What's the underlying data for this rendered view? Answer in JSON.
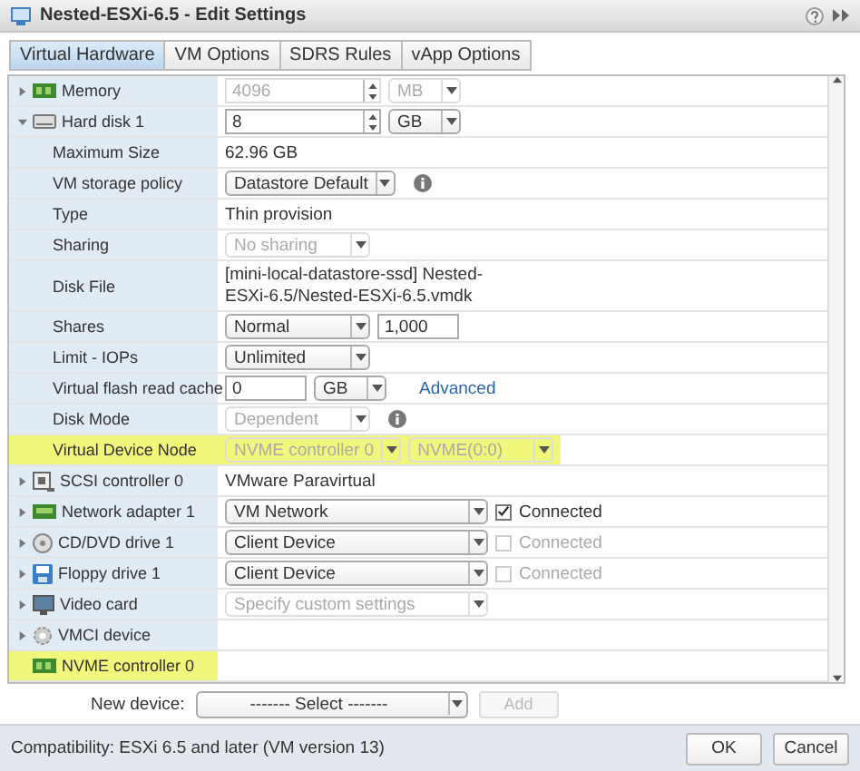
{
  "window": {
    "title": "Nested-ESXi-6.5 - Edit Settings"
  },
  "tabs": [
    {
      "label": "Virtual Hardware",
      "selected": true
    },
    {
      "label": "VM Options",
      "selected": false
    },
    {
      "label": "SDRS Rules",
      "selected": false
    },
    {
      "label": "vApp Options",
      "selected": false
    }
  ],
  "rows": [
    {
      "kind": "memory",
      "label": "Memory",
      "expanded": false,
      "highlighted": false,
      "controls": [
        {
          "kind": "spin",
          "value": "4096",
          "disabled": true
        },
        {
          "kind": "unit",
          "value": "MB",
          "disabled": true
        }
      ]
    },
    {
      "kind": "disk",
      "label": "Hard disk 1",
      "expanded": true,
      "highlighted": false,
      "controls": [
        {
          "kind": "spin",
          "value": "8",
          "disabled": false
        },
        {
          "kind": "unit",
          "value": "GB",
          "disabled": false
        }
      ]
    },
    {
      "kind": "property",
      "label": "Maximum Size",
      "highlighted": false,
      "controls": [
        {
          "kind": "text",
          "value": "62.96 GB"
        }
      ]
    },
    {
      "kind": "property",
      "label": "VM storage policy",
      "highlighted": false,
      "controls": [
        {
          "kind": "dropdown",
          "value": "Datastore Default",
          "disabled": false
        },
        {
          "kind": "info"
        }
      ]
    },
    {
      "kind": "property",
      "label": "Type",
      "highlighted": false,
      "controls": [
        {
          "kind": "text",
          "value": "Thin provision"
        }
      ]
    },
    {
      "kind": "property",
      "label": "Sharing",
      "highlighted": false,
      "controls": [
        {
          "kind": "dropdown",
          "value": "No sharing",
          "disabled": true
        }
      ]
    },
    {
      "kind": "property",
      "label": "Disk File",
      "highlighted": false,
      "controls": [
        {
          "kind": "text",
          "value": "[mini-local-datastore-ssd] Nested-ESXi-6.5/Nested-ESXi-6.5.vmdk"
        }
      ]
    },
    {
      "kind": "property",
      "label": "Shares",
      "highlighted": false,
      "controls": [
        {
          "kind": "dropdown",
          "value": "Normal",
          "disabled": false
        },
        {
          "kind": "input",
          "value": "1,000"
        }
      ]
    },
    {
      "kind": "property",
      "label": "Limit - IOPs",
      "highlighted": false,
      "controls": [
        {
          "kind": "dropdown",
          "value": "Unlimited",
          "disabled": false
        }
      ]
    },
    {
      "kind": "property",
      "label": "Virtual flash read cache",
      "highlighted": false,
      "controls": [
        {
          "kind": "input",
          "value": "0"
        },
        {
          "kind": "unit",
          "value": "GB",
          "disabled": false
        },
        {
          "kind": "link",
          "value": "Advanced"
        }
      ]
    },
    {
      "kind": "property",
      "label": "Disk Mode",
      "highlighted": false,
      "controls": [
        {
          "kind": "dropdown",
          "value": "Dependent",
          "disabled": true
        },
        {
          "kind": "info"
        }
      ]
    },
    {
      "kind": "property",
      "label": "Virtual Device Node",
      "highlighted": true,
      "controls": [
        {
          "kind": "dropdown",
          "value": "NVME controller 0",
          "disabled": true
        },
        {
          "kind": "dropdown",
          "value": "NVME(0:0)",
          "disabled": true
        }
      ]
    },
    {
      "kind": "scsi",
      "label": "SCSI controller 0",
      "expanded": false,
      "highlighted": false,
      "controls": [
        {
          "kind": "text",
          "value": "VMware Paravirtual"
        }
      ]
    },
    {
      "kind": "network",
      "label": "Network adapter 1",
      "expanded": false,
      "highlighted": false,
      "controls": [
        {
          "kind": "dropdown",
          "value": "VM Network",
          "disabled": false
        },
        {
          "kind": "checkbox",
          "value": "Connected",
          "checked": true,
          "disabled": false
        }
      ]
    },
    {
      "kind": "cdrom",
      "label": "CD/DVD drive 1",
      "expanded": false,
      "highlighted": false,
      "controls": [
        {
          "kind": "dropdown",
          "value": "Client Device",
          "disabled": false
        },
        {
          "kind": "checkbox",
          "value": "Connected",
          "checked": false,
          "disabled": true
        }
      ]
    },
    {
      "kind": "floppy",
      "label": "Floppy drive 1",
      "expanded": false,
      "highlighted": false,
      "controls": [
        {
          "kind": "dropdown",
          "value": "Client Device",
          "disabled": false
        },
        {
          "kind": "checkbox",
          "value": "Connected",
          "checked": false,
          "disabled": true
        }
      ]
    },
    {
      "kind": "video",
      "label": "Video card",
      "expanded": false,
      "highlighted": false,
      "controls": [
        {
          "kind": "dropdown",
          "value": "Specify custom settings",
          "disabled": true
        }
      ]
    },
    {
      "kind": "vmci",
      "label": "VMCI device",
      "expanded": false,
      "highlighted": false,
      "controls": []
    },
    {
      "kind": "nvme",
      "label": "NVME controller 0",
      "highlighted": true,
      "controls": []
    }
  ],
  "new_device": {
    "label": "New device:",
    "select": "------- Select -------",
    "add": "Add",
    "add_disabled": true
  },
  "footer": {
    "compatibility": "Compatibility: ESXi 6.5 and later (VM version 13)",
    "buttons": [
      "OK",
      "Cancel"
    ]
  }
}
